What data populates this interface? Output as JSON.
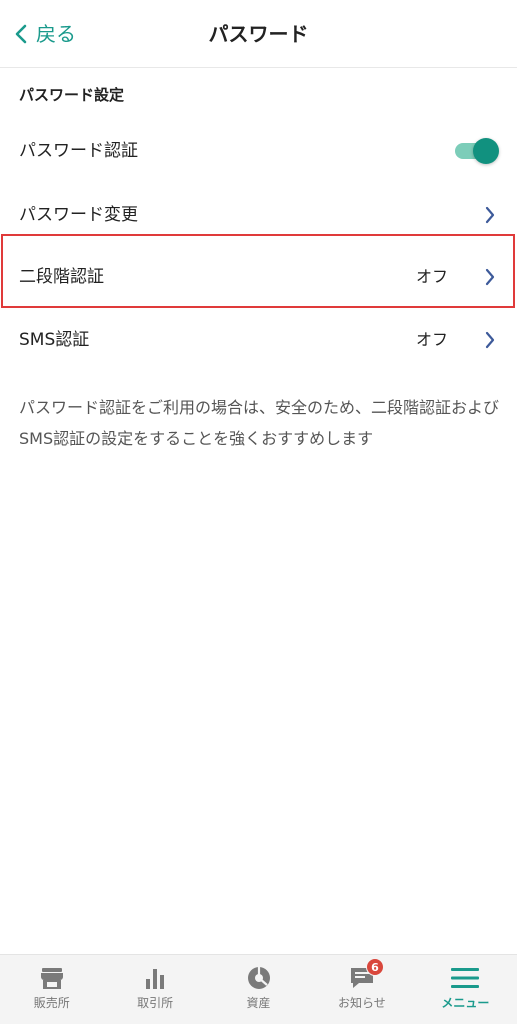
{
  "header": {
    "back_label": "戻る",
    "title": "パスワード"
  },
  "section": {
    "heading": "パスワード設定"
  },
  "rows": {
    "password_auth": {
      "label": "パスワード認証",
      "toggle_on": true
    },
    "password_change": {
      "label": "パスワード変更"
    },
    "two_factor": {
      "label": "二段階認証",
      "value": "オフ"
    },
    "sms_auth": {
      "label": "SMS認証",
      "value": "オフ"
    }
  },
  "note": "パスワード認証をご利用の場合は、安全のため、二段階認証およびSMS認証の設定をすることを強くおすすめします",
  "bottom_nav": {
    "items": [
      {
        "label": "販売所",
        "icon": "store-icon"
      },
      {
        "label": "取引所",
        "icon": "bar-chart-icon"
      },
      {
        "label": "資産",
        "icon": "pie-chart-icon"
      },
      {
        "label": "お知らせ",
        "icon": "message-icon",
        "badge": "6"
      },
      {
        "label": "メニュー",
        "icon": "menu-icon",
        "active": true
      }
    ]
  },
  "colors": {
    "accent": "#1a9a8c",
    "toggle_track": "#7ccdb9",
    "toggle_knob": "#11917f",
    "chevron": "#3d5a9a",
    "highlight": "#e03a3a",
    "badge": "#d9473c"
  }
}
